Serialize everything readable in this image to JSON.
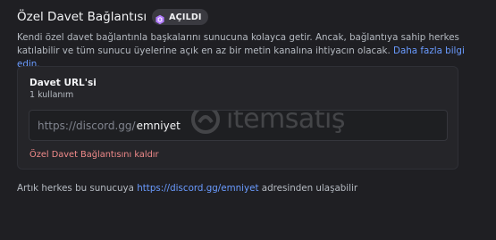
{
  "header": {
    "title": "Özel Davet Bağlantısı",
    "badge_label": "AÇILDI",
    "badge_color": "#b17bff"
  },
  "description": {
    "text": "Kendi özel davet bağlantınla başkalarını sunucuna kolayca getir. Ancak, bağlantıya sahip herkes katılabilir ve tüm sunucu üyelerine açık en az bir metin kanalına ihtiyacın olacak.",
    "link_text": "Daha fazla bilgi edin."
  },
  "card": {
    "label": "Davet URL'si",
    "usage": "1 kullanım",
    "url_prefix": "https://discord.gg/",
    "url_value": "emniyet",
    "remove_label": "Özel Davet Bağlantısını kaldır"
  },
  "watermark": {
    "text": "itemsatış"
  },
  "footer": {
    "text_before": "Artık herkes bu sunucuya",
    "link": "https://discord.gg/emniyet",
    "text_after": "adresinden ulaşabilir"
  },
  "colors": {
    "link": "#6a9bff",
    "danger": "#f08a8a",
    "background": "#1f1f23"
  }
}
